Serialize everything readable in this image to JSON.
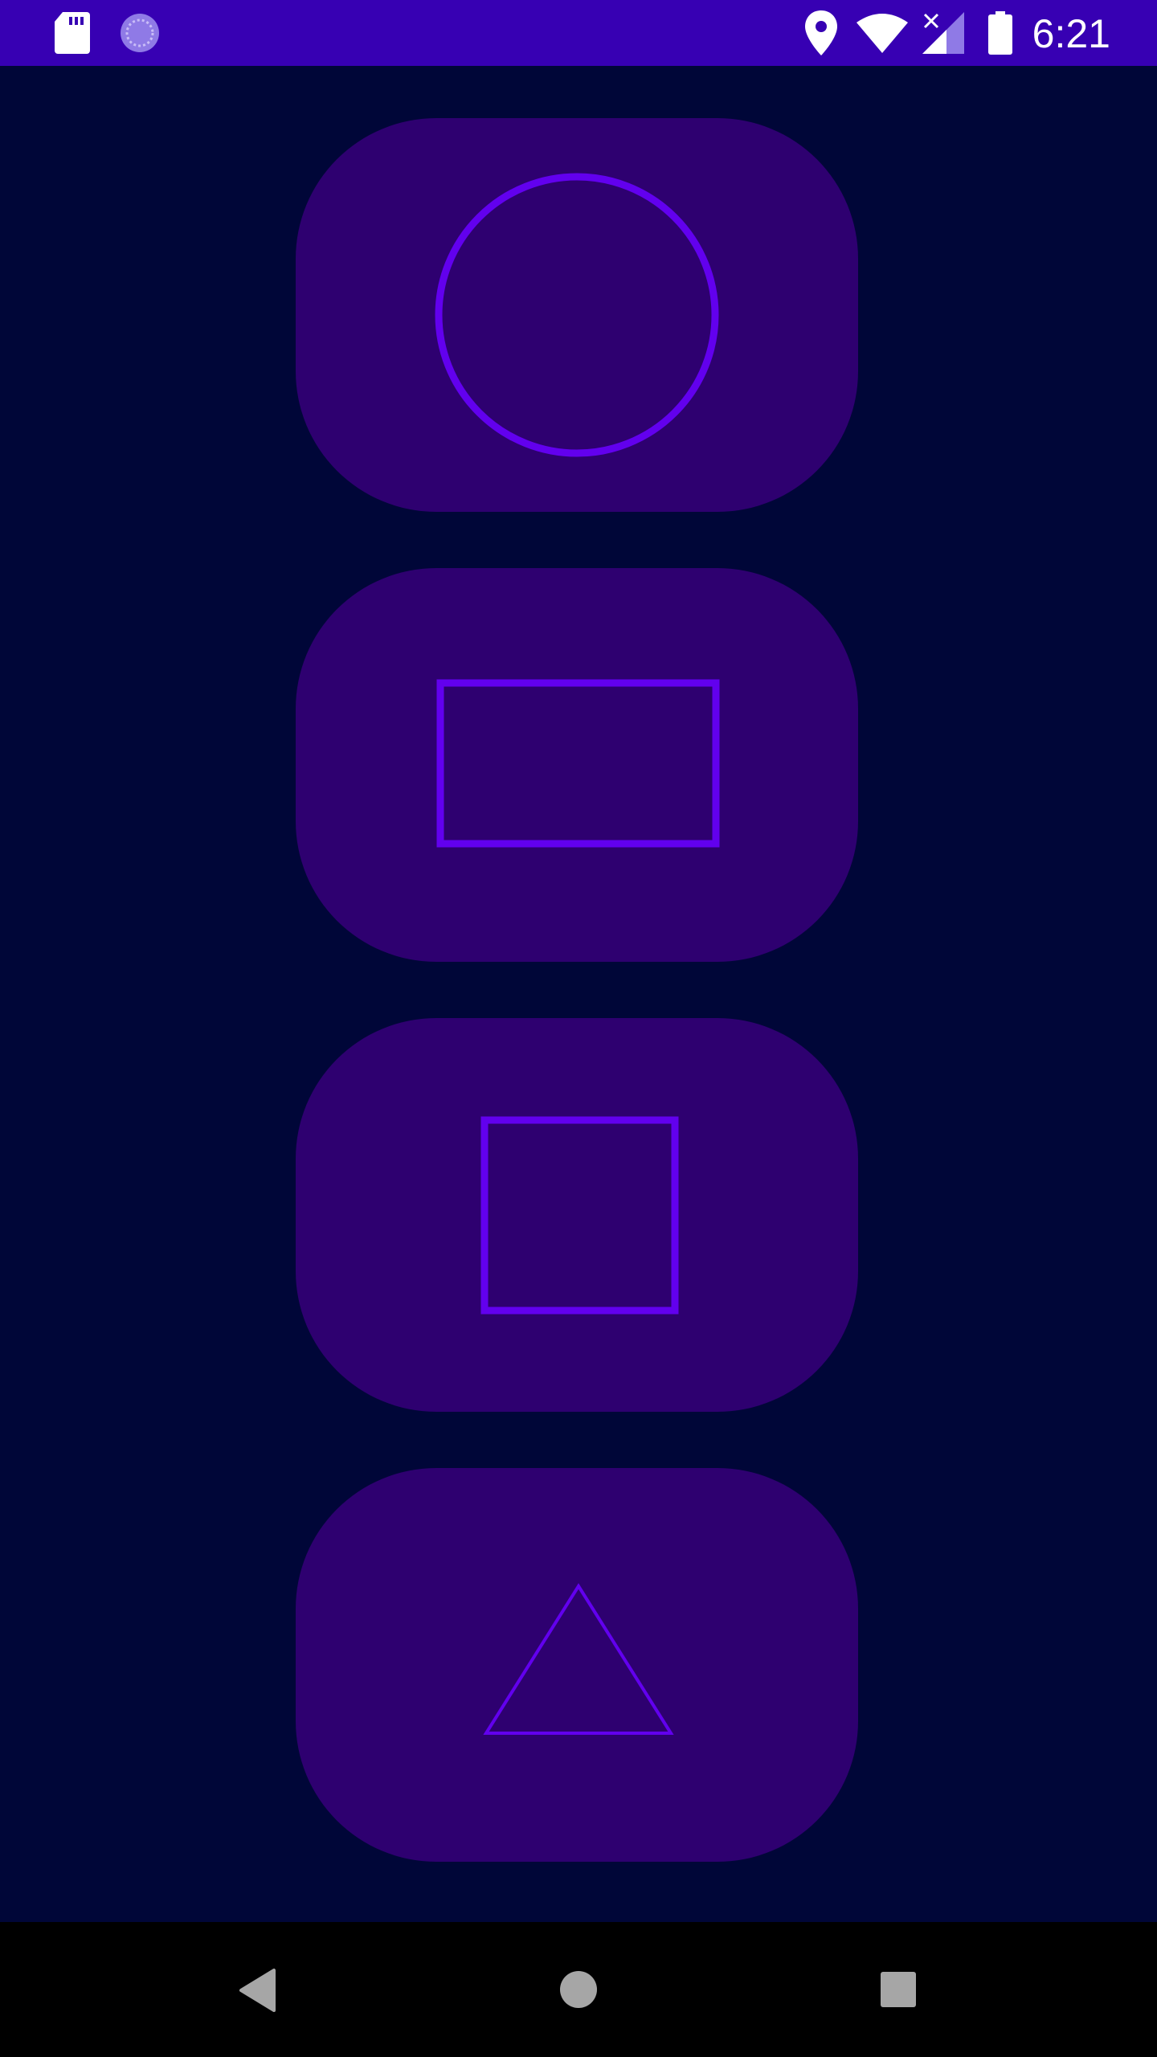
{
  "status_bar": {
    "time": "6:21",
    "left_icons": [
      "sd-card-icon",
      "sync-progress-icon"
    ],
    "right_icons": [
      "location-icon",
      "wifi-icon",
      "cell-signal-no-data-icon",
      "battery-icon"
    ]
  },
  "shape_buttons": [
    {
      "name": "circle-button",
      "icon": "circle-icon"
    },
    {
      "name": "rectangle-button",
      "icon": "rectangle-icon"
    },
    {
      "name": "square-button",
      "icon": "square-icon"
    },
    {
      "name": "triangle-button",
      "icon": "triangle-icon"
    }
  ],
  "nav_bar": {
    "buttons": [
      "back-button",
      "home-button",
      "recents-button"
    ]
  },
  "colors": {
    "status_bar": "#3700b3",
    "background": "#000638",
    "card": "#2e0070",
    "shape_stroke": "#6200ee",
    "nav_bar": "#000000",
    "nav_icon": "#a6a6a6"
  }
}
